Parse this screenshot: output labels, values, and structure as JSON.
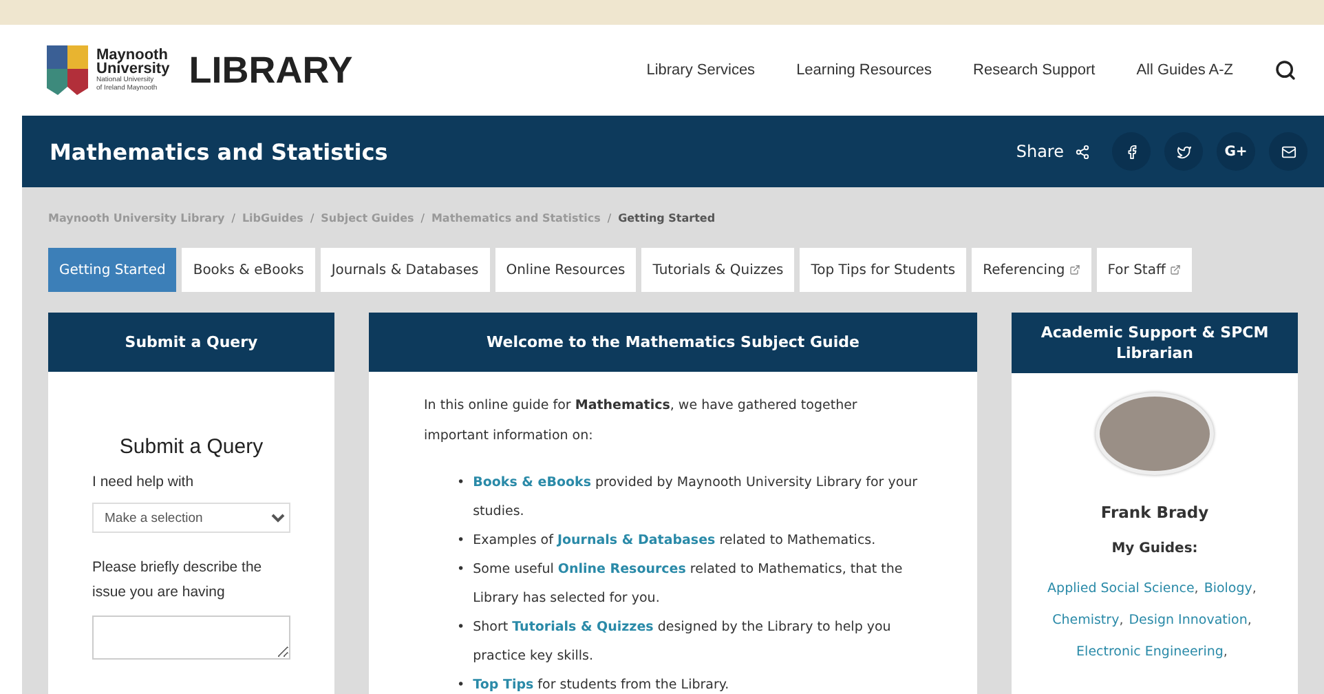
{
  "logo": {
    "name_lines": [
      "Maynooth",
      "University"
    ],
    "sub_lines": [
      "National University",
      "of Ireland Maynooth"
    ],
    "wordmark": "LIBRARY"
  },
  "nav": [
    "Library Services",
    "Learning Resources",
    "Research Support",
    "All Guides A-Z"
  ],
  "banner": {
    "title": "Mathematics and Statistics",
    "share_label": "Share",
    "social": [
      {
        "kind": "facebook"
      },
      {
        "kind": "twitter"
      },
      {
        "kind": "text",
        "label": "G+"
      },
      {
        "kind": "mail"
      }
    ]
  },
  "breadcrumb": [
    {
      "label": "Maynooth University Library",
      "current": false
    },
    {
      "separator": "/",
      "label": "LibGuides",
      "current": false
    },
    {
      "separator": "/",
      "label": "Subject Guides",
      "current": false
    },
    {
      "separator": "/",
      "label": "Mathematics and Statistics",
      "current": false
    },
    {
      "separator": "/",
      "label": "Getting Started",
      "current": true
    }
  ],
  "tabs": [
    {
      "label": "Getting Started",
      "selected": true,
      "external": false
    },
    {
      "label": "Books & eBooks",
      "selected": false,
      "external": false
    },
    {
      "label": "Journals & Databases",
      "selected": false,
      "external": false
    },
    {
      "label": "Online Resources",
      "selected": false,
      "external": false
    },
    {
      "label": "Tutorials & Quizzes",
      "selected": false,
      "external": false
    },
    {
      "label": "Top Tips for Students",
      "selected": false,
      "external": false
    },
    {
      "label": "Referencing",
      "selected": false,
      "external": true
    },
    {
      "label": "For Staff",
      "selected": false,
      "external": true
    }
  ],
  "query_panel": {
    "header": "Submit a Query",
    "form_title": "Submit a Query",
    "help_label": "I need help with",
    "help_select": "Make a selection",
    "describe_label": "Please briefly describe the issue you are having"
  },
  "welcome_panel": {
    "header": "Welcome to the Mathematics Subject Guide",
    "intro": "In this online guide for **Mathematics**, we have gathered together important information on:",
    "bullets": [
      {
        "marker": "•",
        "link": "Books & eBooks",
        "after": " provided by Maynooth University Library for your studies."
      },
      {
        "marker": "•",
        "before": "Examples of ",
        "link": "Journals & Databases",
        "after": " related to Mathematics."
      },
      {
        "marker": "•",
        "before": "Some useful ",
        "link": "Online Resources",
        "after": " related to Mathematics, that the Library has selected for you."
      },
      {
        "marker": "•",
        "before": "Short ",
        "link": "Tutorials & Quizzes",
        "after": " designed by the Library to help you practice key skills."
      },
      {
        "marker": "•",
        "link": "Top Tips",
        "after": " for students from the Library."
      }
    ]
  },
  "librarian_panel": {
    "header": "Academic Support & SPCM Librarian",
    "name": "Frank Brady",
    "guides_label": "My Guides:",
    "guides": [
      {
        "label": "Applied Social Science",
        "separator": ","
      },
      {
        "label": "Biology",
        "separator": ","
      },
      {
        "label": "Chemistry",
        "separator": ","
      },
      {
        "label": "Design Innovation",
        "separator": ","
      },
      {
        "label": "Electronic Engineering",
        "separator": ","
      }
    ]
  }
}
